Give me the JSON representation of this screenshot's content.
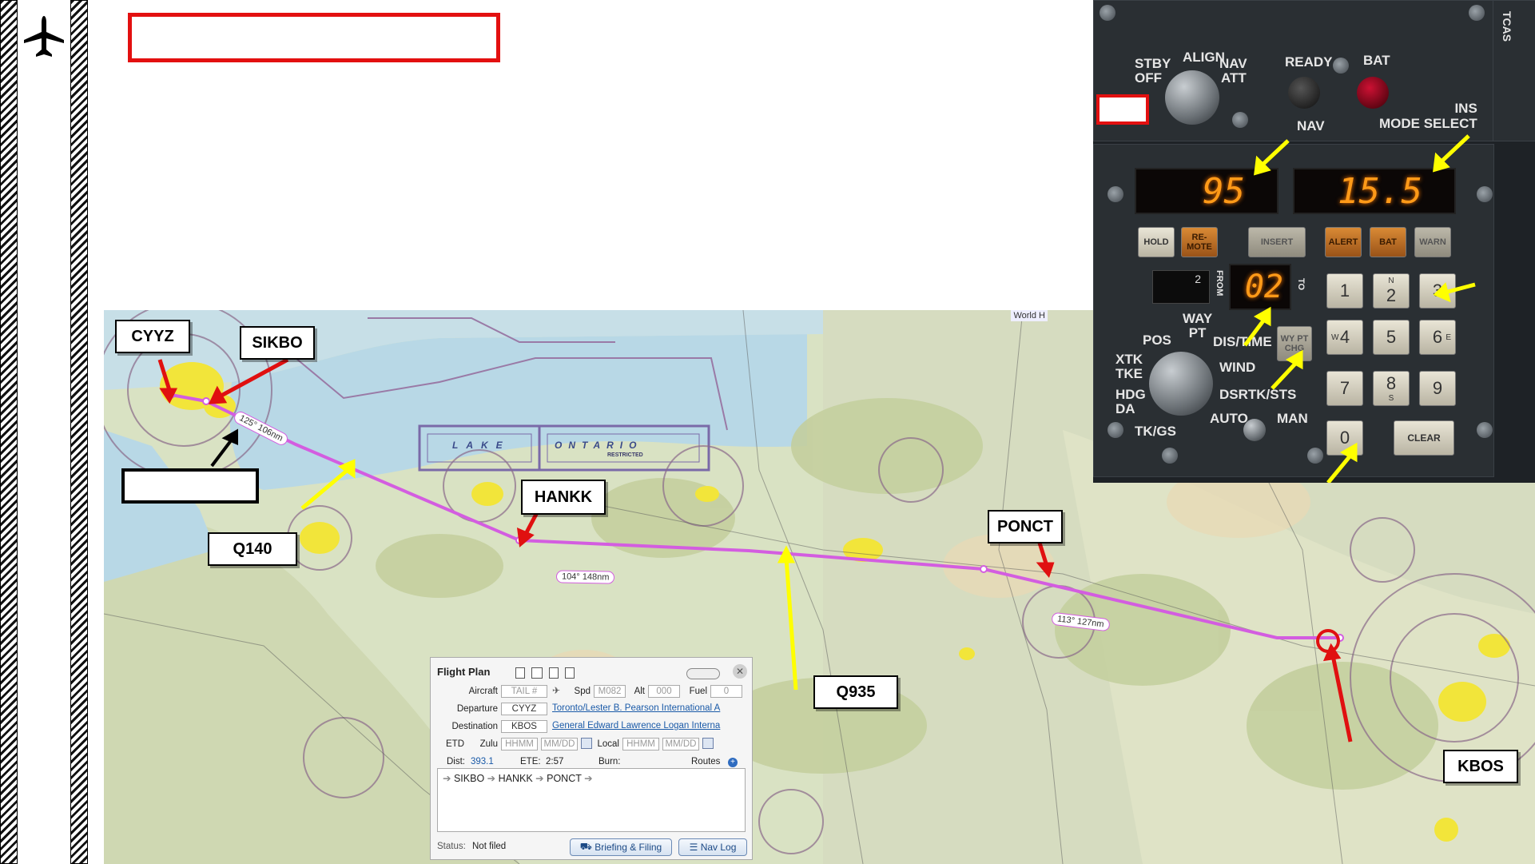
{
  "callouts": {
    "cyyz": "CYYZ",
    "sikbo": "SIKBO",
    "hankk": "HANKK",
    "ponct": "PONCT",
    "kbos": "KBOS",
    "q140": "Q140",
    "q935": "Q935"
  },
  "map": {
    "world_label": "World H",
    "lake_label_1": "LAKE",
    "lake_label_2": "ONTARIO",
    "restricted_label": "RESTRICTED",
    "leg_labels": [
      "125° 106nm",
      "104° 148nm",
      "113° 127nm"
    ],
    "route_color": "#d35de0"
  },
  "ins_panel": {
    "mode_labels": {
      "stby": "STBY",
      "off": "OFF",
      "align": "ALIGN",
      "nav": "NAV",
      "att": "ATT",
      "ready": "READY",
      "bat": "BAT",
      "nav_lower": "NAV",
      "ins_mode_select": "INS\nMODE SELECT",
      "tcas": "TCAS"
    },
    "display_left": "95",
    "display_right": "15.5",
    "waypoint_display": "02",
    "from_label": "FROM",
    "to_label": "TO",
    "thumbwheel": "2",
    "status_keys": [
      "HOLD",
      "RE-\nMOTE",
      "INSERT",
      "ALERT",
      "BAT",
      "WARN"
    ],
    "keypad": {
      "k1": "1",
      "k2": "2",
      "k2_sub": "N",
      "k3": "3",
      "k4": "4",
      "k4_sub": "W",
      "k5": "5",
      "k6": "6",
      "k6_sub": "E",
      "k7": "7",
      "k8": "8",
      "k8_sub": "S",
      "k9": "9",
      "k0": "0",
      "clear": "CLEAR",
      "wypt_chg": "WY PT\nCHG"
    },
    "selector_labels": {
      "waypt": "WAY\nPT",
      "pos": "POS",
      "distime": "DIS/TIME",
      "xtk": "XTK",
      "tke": "TKE",
      "wind": "WIND",
      "hdg": "HDG",
      "da": "DA",
      "dsrtk": "DSRTK/STS",
      "tkgs": "TK/GS",
      "auto": "AUTO",
      "man": "MAN"
    }
  },
  "flight_plan": {
    "title": "Flight Plan",
    "aircraft_label": "Aircraft",
    "aircraft_placeholder": "TAIL #",
    "spd_label": "Spd",
    "spd_placeholder": "M082",
    "alt_label": "Alt",
    "alt_placeholder": "000",
    "fuel_label": "Fuel",
    "fuel_placeholder": "0",
    "departure_label": "Departure",
    "departure_code": "CYYZ",
    "departure_name": "Toronto/Lester B. Pearson International A",
    "destination_label": "Destination",
    "destination_code": "KBOS",
    "destination_name": "General Edward Lawrence Logan Interna",
    "etd_label": "ETD",
    "zulu_label": "Zulu",
    "zulu_time_placeholder": "HHMM",
    "zulu_date_placeholder": "MM/DD",
    "local_label": "Local",
    "local_time_placeholder": "HHMM",
    "local_date_placeholder": "MM/DD",
    "dist_label": "Dist:",
    "dist_value": "393.1",
    "ete_label": "ETE:",
    "ete_value": "2:57",
    "burn_label": "Burn:",
    "routes_label": "Routes",
    "route_items": [
      "SIKBO",
      "HANKK",
      "PONCT"
    ],
    "status_label": "Status:",
    "status_value": "Not filed",
    "briefing_button": "Briefing & Filing",
    "navlog_button": "Nav Log"
  }
}
